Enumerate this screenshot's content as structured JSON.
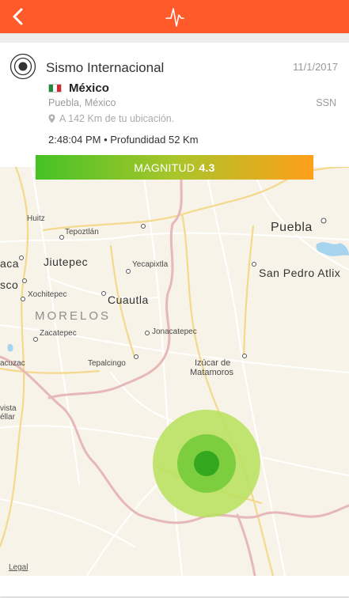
{
  "header": {
    "back_icon": "chevron-left-icon",
    "logo_icon": "pulse-icon"
  },
  "event": {
    "icon": "target-icon",
    "title": "Sismo Internacional",
    "date": "11/1/2017",
    "country_flag": "mexico-flag-icon",
    "country": "México",
    "location": "Puebla, México",
    "agency": "SSN",
    "distance": "A 142 Km de tu ubicación.",
    "time_depth": "2:48:04 PM • Profundidad 52 Km"
  },
  "magnitude": {
    "label": "MAGNITUD",
    "value": "4.3"
  },
  "map": {
    "labels": {
      "huitz": "Huitz",
      "tepoztlan": "Tepoztlán",
      "puebla": "Puebla",
      "aca": "aca",
      "jiutepec": "Jiutepec",
      "yecapixtla": "Yecapixtla",
      "san_pedro": "San Pedro Atlix",
      "sco": "sco",
      "xochitepec": "Xochitepec",
      "cuautla": "Cuautla",
      "morelos": "MORELOS",
      "jonacatepec": "Jonacatepec",
      "zacatepec": "Zacatepec",
      "acuzac": "acuzac",
      "tepalcingo": "Tepalcingo",
      "izucar_1": "Izúcar de",
      "izucar_2": "Matamoros",
      "vista_1": "vista",
      "vista_2": "éllar"
    },
    "legal": "Legal",
    "colors": {
      "outer": "#b9e05e",
      "middle": "#79cc3c",
      "inner": "#33a81f"
    }
  },
  "theme": {
    "header_bg": "#ff5a2a"
  }
}
